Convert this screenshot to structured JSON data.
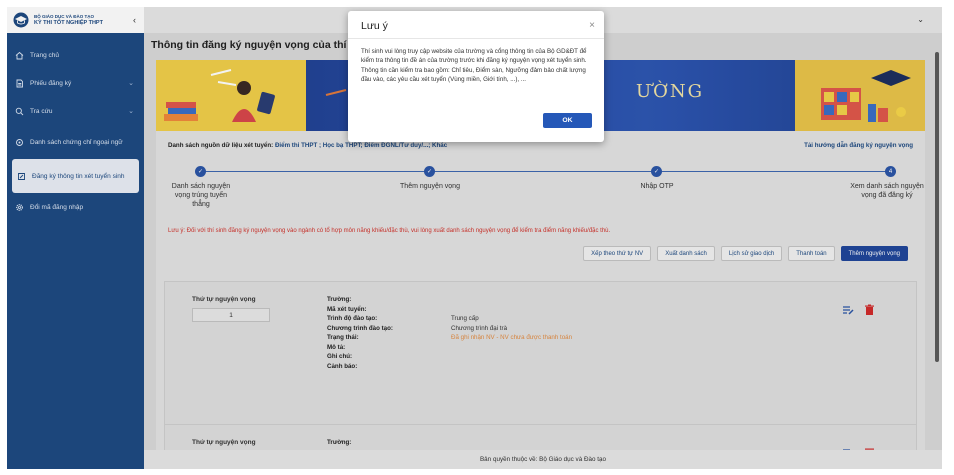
{
  "sidebar": {
    "logo_line1": "BỘ GIÁO DỤC VÀ ĐÀO TẠO",
    "logo_line2": "KỲ THI TỐT NGHIỆP THPT",
    "collapse_glyph": "‹",
    "items": [
      {
        "label": "Trang chủ",
        "icon": "home-icon"
      },
      {
        "label": "Phiếu đăng ký",
        "icon": "document-icon",
        "chevron": "⌄"
      },
      {
        "label": "Tra cứu",
        "icon": "search-icon",
        "chevron": "⌄"
      },
      {
        "label": "Danh sách chứng chỉ ngoại ngữ",
        "icon": "certificate-icon"
      },
      {
        "label": "Đăng ký thông tin xét tuyển sinh",
        "icon": "edit-icon",
        "active": true
      },
      {
        "label": "Đổi mã đăng nhập",
        "icon": "gear-icon"
      }
    ]
  },
  "topbar": {
    "chevron": "⌄"
  },
  "main": {
    "title": "Thông tin đăng ký nguyện vọng của thí sinh",
    "banner_word": "ƯỜNG",
    "source_label": "Danh sách nguồn dữ liệu xét tuyển:",
    "source_value": "Điểm thi THPT ; Học bạ THPT; Điểm ĐGNL/Tư duy/...; Khác",
    "guide_link": "Tải hướng dẫn đăng ký nguyện vọng",
    "steps": [
      {
        "label": "Danh sách nguyện vọng trúng tuyển thẳng",
        "mark": "✓"
      },
      {
        "label": "Thêm nguyện vọng",
        "mark": "✓"
      },
      {
        "label": "Nhập OTP",
        "mark": "✓"
      },
      {
        "label": "Xem danh sách nguyện vọng đã đăng ký",
        "mark": "4"
      }
    ],
    "note": "Lưu ý: Đối với thí sinh đăng ký nguyện vọng vào ngành có tổ hợp môn năng khiếu/đặc thù, vui lòng xuất danh sách nguyện vọng để kiểm tra điểm năng khiếu/đặc thù.",
    "buttons": {
      "sort": "Xếp theo thứ tự NV",
      "export": "Xuất danh sách",
      "history": "Lịch sử giao dịch",
      "payment": "Thanh toán",
      "add": "Thêm nguyện vọng"
    },
    "card1": {
      "order_label": "Thứ tự nguyện vọng",
      "order_value": "1",
      "fields": [
        {
          "key": "Trường:",
          "value": ""
        },
        {
          "key": "Mã xét tuyển:",
          "value": ""
        },
        {
          "key": "Trình độ đào tạo:",
          "value": "Trung cấp"
        },
        {
          "key": "Chương trình đào tạo:",
          "value": "Chương trình đại trà"
        },
        {
          "key": "Trạng thái:",
          "value": "Đã ghi nhận NV - NV chưa được thanh toán"
        },
        {
          "key": "Mô tả:",
          "value": ""
        },
        {
          "key": "Ghi chú:",
          "value": ""
        },
        {
          "key": "Cảnh báo:",
          "value": ""
        }
      ]
    },
    "card2": {
      "order_label": "Thứ tự nguyện vọng",
      "field_key": "Trường:"
    }
  },
  "footer": "Bản quyền thuộc về: Bộ Giáo dục và Đào tạo",
  "modal": {
    "title": "Lưu ý",
    "close": "×",
    "paragraph1": "Thí sinh vui lòng truy cập website của trường và cổng thông tin của Bộ GD&ĐT để kiểm tra thông tin đề án của trường trước khi đăng ký nguyện vọng xét tuyển sinh.",
    "paragraph2": "Thông tin cần kiểm tra bao gồm: Chỉ tiêu, Điểm sàn, Ngưỡng đảm bảo chất lượng đầu vào, các yêu cầu xét tuyển (Vùng miền, Giới tính, ...), ...",
    "ok": "OK"
  },
  "colors": {
    "sidebar": "#1e4a82",
    "primary": "#20469a",
    "warning": "#d0332c",
    "status": "#e28c43"
  }
}
